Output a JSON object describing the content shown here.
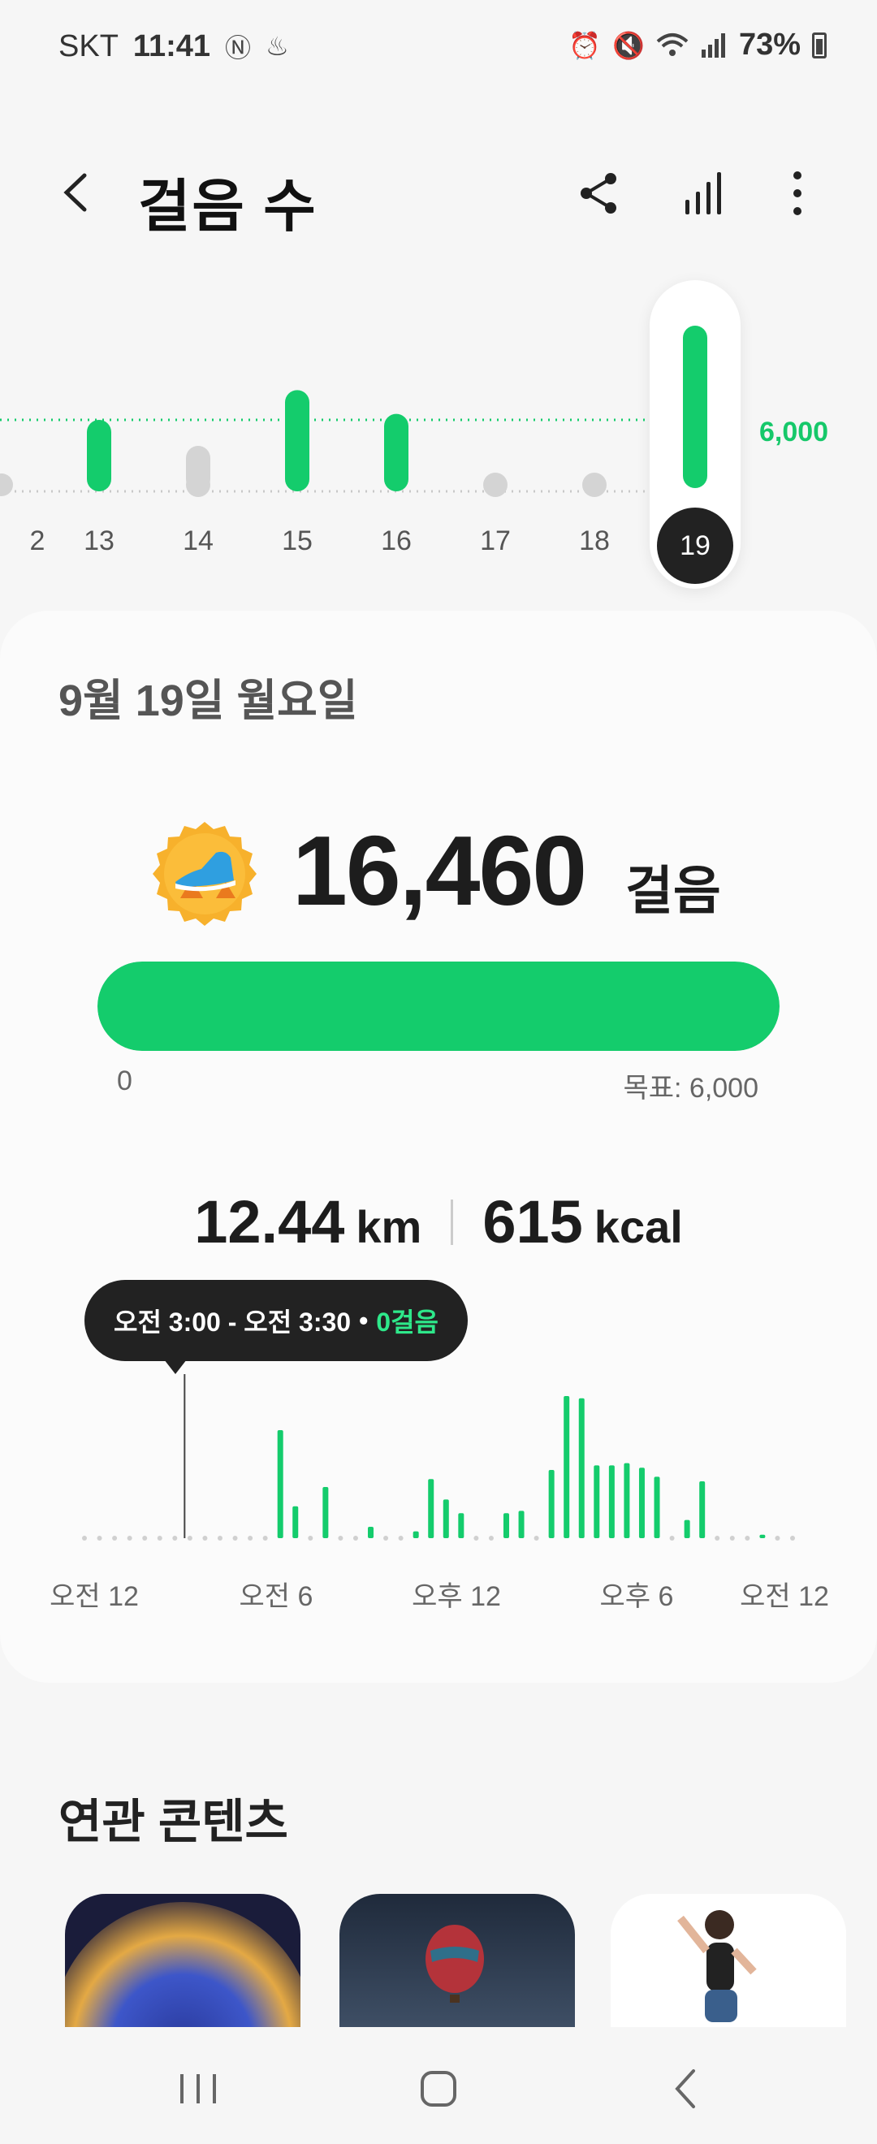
{
  "status_bar": {
    "carrier": "SKT",
    "time": "11:41",
    "battery": "73%"
  },
  "header": {
    "title": "걸음 수"
  },
  "daily": {
    "days": [
      "2",
      "13",
      "14",
      "15",
      "16",
      "17",
      "18",
      "19"
    ],
    "selected_day": "19",
    "goal_label": "6,000",
    "bars": [
      {
        "day": "13",
        "steps": 6000
      },
      {
        "day": "14",
        "steps": 0
      },
      {
        "day": "15",
        "steps": 8500
      },
      {
        "day": "16",
        "steps": 6500
      },
      {
        "day": "17",
        "steps": 0
      },
      {
        "day": "18",
        "steps": 0
      },
      {
        "day": "19",
        "steps": 16460
      }
    ]
  },
  "summary": {
    "date": "9월 19일 월요일",
    "steps": "16,460",
    "steps_unit": "걸음",
    "progress_fraction": 1.0,
    "progress_min": "0",
    "progress_goal": "목표: 6,000",
    "distance_value": "12.44",
    "distance_unit": "km",
    "calories_value": "615",
    "calories_unit": "kcal"
  },
  "tooltip": {
    "range": "오전 3:00 - 오전 3:30",
    "bullet": "•",
    "value": "0걸음"
  },
  "hourly_chart": {
    "x_labels": [
      "오전 12",
      "오전 6",
      "오후 12",
      "오후 6",
      "오전 12"
    ],
    "bars": [
      {
        "slot": 13,
        "v": 95
      },
      {
        "slot": 14,
        "v": 28
      },
      {
        "slot": 16,
        "v": 45
      },
      {
        "slot": 19,
        "v": 10
      },
      {
        "slot": 22,
        "v": 6
      },
      {
        "slot": 23,
        "v": 52
      },
      {
        "slot": 24,
        "v": 34
      },
      {
        "slot": 25,
        "v": 22
      },
      {
        "slot": 28,
        "v": 22
      },
      {
        "slot": 29,
        "v": 24
      },
      {
        "slot": 31,
        "v": 60
      },
      {
        "slot": 32,
        "v": 125
      },
      {
        "slot": 33,
        "v": 123
      },
      {
        "slot": 34,
        "v": 64
      },
      {
        "slot": 35,
        "v": 64
      },
      {
        "slot": 36,
        "v": 66
      },
      {
        "slot": 37,
        "v": 62
      },
      {
        "slot": 38,
        "v": 54
      },
      {
        "slot": 40,
        "v": 16
      },
      {
        "slot": 41,
        "v": 50
      },
      {
        "slot": 45,
        "v": 3
      }
    ],
    "selected_slot": 6
  },
  "related": {
    "title": "연관 콘텐츠"
  },
  "colors": {
    "accent": "#14cc6c",
    "inactive": "#d4d4d4"
  }
}
